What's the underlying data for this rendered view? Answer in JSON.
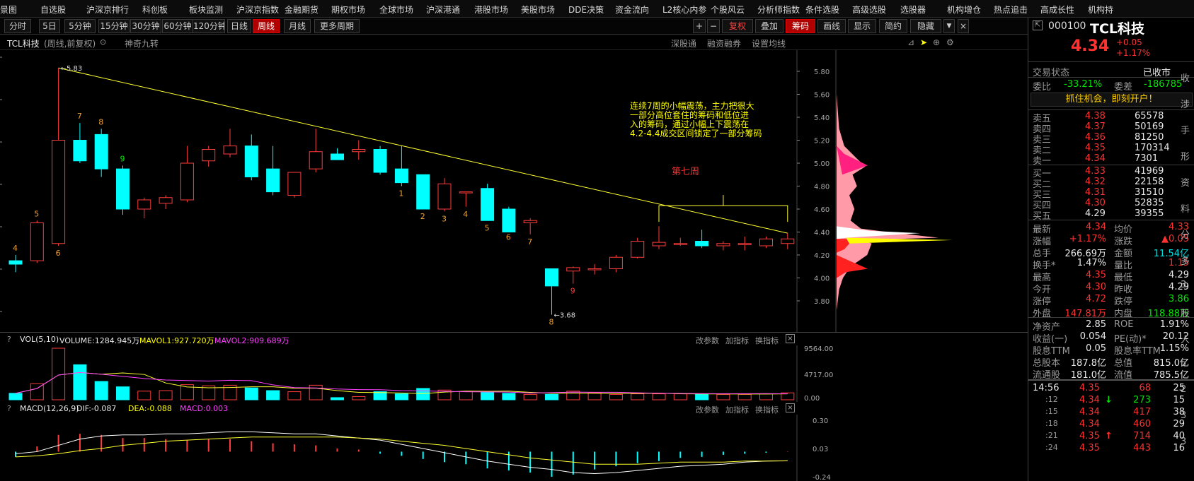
{
  "menu": [
    "景图",
    "自选股",
    "沪深京排行",
    "科创板",
    "板块监测",
    "沪深京指数",
    "金融期货",
    "期权市场",
    "全球市场",
    "沪深港通",
    "港股市场",
    "美股市场",
    "DDE决策",
    "资金流向",
    "L2核心内参",
    "个股风云",
    "分析师指数",
    "条件选股",
    "高级选股",
    "选股器",
    "机构增仓",
    "热点追击",
    "高成长性",
    "机构持"
  ],
  "periods": [
    "分时",
    "5日",
    "5分钟",
    "15分钟",
    "30分钟",
    "60分钟",
    "120分钟",
    "日线",
    "周线",
    "月线",
    "更多周期"
  ],
  "tools": [
    "+",
    "−",
    "复权",
    "叠加",
    "筹码",
    "画线",
    "显示",
    "简约",
    "隐藏"
  ],
  "stock": {
    "code": "000100",
    "name": "TCL科技",
    "price": "4.34",
    "change": "+0.05",
    "change_pct": "+1.17%"
  },
  "chart_header": {
    "name": "TCL科技",
    "mode": "(周线,前复权)",
    "indicator": "神奇九转",
    "right": [
      "深股通",
      "融资融券",
      "设置均线"
    ]
  },
  "annotation": {
    "text_lines": [
      "连续7周的小幅震荡，主力把很大",
      "一部分高位套住的筹码和低位进",
      "入的筹码，通过小幅上下震荡在",
      "4.2-4.4成交区间锁定了一部分筹码"
    ],
    "week7": "第七周"
  },
  "price_labels": [
    "5.80",
    "5.60",
    "5.40",
    "5.20",
    "5.00",
    "4.80",
    "4.60",
    "4.40",
    "4.20",
    "4.00",
    "3.80"
  ],
  "high_label": "5.83",
  "low_label": "3.68",
  "vol": {
    "name": "VOL(5,10)",
    "volume": "VOLUME:1284.945万",
    "mavol1": "MAVOL1:927.720万",
    "mavol2": "MAVOL2:909.689万",
    "axis": [
      "9564.00",
      "4717.00",
      "0.00"
    ],
    "actions": [
      "改参数",
      "加指标",
      "换指标"
    ]
  },
  "macd": {
    "name": "MACD(12,26,9)",
    "dif": "DIF:-0.087",
    "dea": "DEA:-0.088",
    "macd": "MACD:0.003",
    "axis": [
      "0.30",
      "0.03",
      "-0.24"
    ],
    "actions": [
      "改参数",
      "加指标",
      "换指标"
    ]
  },
  "chart_data": {
    "type": "candlestick",
    "candles": [
      {
        "o": 4.15,
        "h": 4.2,
        "l": 4.05,
        "c": 4.12
      },
      {
        "o": 4.15,
        "h": 4.5,
        "l": 4.13,
        "c": 4.48
      },
      {
        "o": 4.3,
        "h": 5.83,
        "l": 4.28,
        "c": 5.2
      },
      {
        "o": 5.2,
        "h": 5.35,
        "l": 5.0,
        "c": 5.02
      },
      {
        "o": 5.25,
        "h": 5.3,
        "l": 4.88,
        "c": 4.95
      },
      {
        "o": 4.95,
        "h": 4.98,
        "l": 4.55,
        "c": 4.6
      },
      {
        "o": 4.6,
        "h": 4.7,
        "l": 4.52,
        "c": 4.68
      },
      {
        "o": 4.65,
        "h": 4.72,
        "l": 4.6,
        "c": 4.7
      },
      {
        "o": 4.68,
        "h": 5.15,
        "l": 4.66,
        "c": 5.0
      },
      {
        "o": 5.02,
        "h": 5.15,
        "l": 4.97,
        "c": 5.12
      },
      {
        "o": 5.08,
        "h": 5.3,
        "l": 5.05,
        "c": 5.15
      },
      {
        "o": 5.15,
        "h": 5.25,
        "l": 4.85,
        "c": 4.88
      },
      {
        "o": 4.95,
        "h": 5.15,
        "l": 4.72,
        "c": 4.75
      },
      {
        "o": 4.72,
        "h": 4.9,
        "l": 4.7,
        "c": 4.92
      },
      {
        "o": 4.95,
        "h": 5.3,
        "l": 4.92,
        "c": 5.1
      },
      {
        "o": 5.08,
        "h": 5.13,
        "l": 5.03,
        "c": 5.03
      },
      {
        "o": 5.1,
        "h": 5.2,
        "l": 5.03,
        "c": 5.12
      },
      {
        "o": 5.12,
        "h": 5.15,
        "l": 4.9,
        "c": 4.92
      },
      {
        "o": 4.95,
        "h": 5.15,
        "l": 4.8,
        "c": 4.83
      },
      {
        "o": 4.9,
        "h": 4.9,
        "l": 4.6,
        "c": 4.6
      },
      {
        "o": 4.6,
        "h": 4.87,
        "l": 4.58,
        "c": 4.82
      },
      {
        "o": 4.75,
        "h": 4.75,
        "l": 4.62,
        "c": 4.75
      },
      {
        "o": 4.78,
        "h": 4.82,
        "l": 4.5,
        "c": 4.5
      },
      {
        "o": 4.6,
        "h": 4.62,
        "l": 4.42,
        "c": 4.4
      },
      {
        "o": 4.48,
        "h": 4.52,
        "l": 4.38,
        "c": 4.5
      },
      {
        "o": 4.08,
        "h": 4.08,
        "l": 3.68,
        "c": 3.93
      },
      {
        "o": 4.06,
        "h": 4.1,
        "l": 3.95,
        "c": 4.09
      },
      {
        "o": 4.08,
        "h": 4.12,
        "l": 4.03,
        "c": 4.08
      },
      {
        "o": 4.08,
        "h": 4.2,
        "l": 4.05,
        "c": 4.18
      },
      {
        "o": 4.18,
        "h": 4.35,
        "l": 4.17,
        "c": 4.32
      },
      {
        "o": 4.28,
        "h": 4.45,
        "l": 4.25,
        "c": 4.31
      },
      {
        "o": 4.3,
        "h": 4.35,
        "l": 4.28,
        "c": 4.3
      },
      {
        "o": 4.32,
        "h": 4.42,
        "l": 4.26,
        "c": 4.28
      },
      {
        "o": 4.28,
        "h": 4.32,
        "l": 4.24,
        "c": 4.3
      },
      {
        "o": 4.29,
        "h": 4.36,
        "l": 4.24,
        "c": 4.3
      },
      {
        "o": 4.28,
        "h": 4.36,
        "l": 4.26,
        "c": 4.34
      },
      {
        "o": 4.3,
        "h": 4.39,
        "l": 4.25,
        "c": 4.34
      }
    ],
    "td_labels": [
      {
        "i": 0,
        "t": "4",
        "pos": "above",
        "col": "org"
      },
      {
        "i": 1,
        "t": "5",
        "pos": "above",
        "col": "org"
      },
      {
        "i": 2,
        "t": "6",
        "pos": "below",
        "col": "org"
      },
      {
        "i": 3,
        "t": "7",
        "pos": "above",
        "col": "org"
      },
      {
        "i": 4,
        "t": "8",
        "pos": "above",
        "col": "org"
      },
      {
        "i": 5,
        "t": "9",
        "pos": "above",
        "col": "grn"
      },
      {
        "i": 18,
        "t": "1",
        "pos": "below",
        "col": "org"
      },
      {
        "i": 19,
        "t": "2",
        "pos": "below",
        "col": "org"
      },
      {
        "i": 20,
        "t": "3",
        "pos": "below",
        "col": "org"
      },
      {
        "i": 21,
        "t": "4",
        "pos": "below",
        "col": "org"
      },
      {
        "i": 22,
        "t": "5",
        "pos": "below",
        "col": "org"
      },
      {
        "i": 23,
        "t": "6",
        "pos": "below",
        "col": "org"
      },
      {
        "i": 24,
        "t": "7",
        "pos": "below",
        "col": "org"
      },
      {
        "i": 25,
        "t": "8",
        "pos": "below",
        "col": "org"
      },
      {
        "i": 26,
        "t": "9",
        "pos": "below",
        "col": "redt"
      }
    ],
    "volumes": [
      1200,
      3000,
      9564,
      6500,
      3400,
      2400,
      1600,
      1700,
      2800,
      2600,
      2700,
      2200,
      1700,
      1500,
      2700,
      400,
      600,
      1500,
      1100,
      2100,
      1800,
      1500,
      1400,
      1200,
      1000,
      1000,
      1600,
      1300,
      1000,
      1100,
      1100,
      1100,
      1100,
      1000,
      1000,
      1100,
      1285
    ],
    "vol_ylim": [
      0,
      9564
    ],
    "macd_hist": [
      -0.05,
      0.05,
      0.16,
      0.17,
      0.16,
      0.13,
      0.13,
      0.12,
      0.11,
      0.12,
      0.12,
      0.1,
      0.08,
      0.07,
      0.06,
      0.03,
      0.02,
      -0.02,
      -0.04,
      -0.07,
      -0.1,
      -0.12,
      -0.16,
      -0.18,
      -0.2,
      -0.24,
      -0.22,
      -0.17,
      -0.14,
      -0.11,
      -0.09,
      -0.06,
      -0.05,
      -0.03,
      -0.02,
      -0.01,
      0.003
    ],
    "dif": [
      -0.02,
      0.0,
      0.06,
      0.12,
      0.15,
      0.16,
      0.16,
      0.17,
      0.17,
      0.18,
      0.19,
      0.19,
      0.18,
      0.17,
      0.17,
      0.15,
      0.13,
      0.11,
      0.07,
      0.03,
      -0.01,
      -0.05,
      -0.09,
      -0.12,
      -0.15,
      -0.17,
      -0.2,
      -0.21,
      -0.2,
      -0.18,
      -0.16,
      -0.14,
      -0.13,
      -0.12,
      -0.1,
      -0.09,
      -0.087
    ],
    "dea": [
      -0.05,
      -0.04,
      -0.02,
      0.01,
      0.03,
      0.06,
      0.08,
      0.1,
      0.11,
      0.12,
      0.13,
      0.14,
      0.14,
      0.14,
      0.14,
      0.14,
      0.13,
      0.12,
      0.1,
      0.08,
      0.06,
      0.03,
      0.0,
      -0.03,
      -0.06,
      -0.08,
      -0.1,
      -0.12,
      -0.12,
      -0.12,
      -0.11,
      -0.1,
      -0.1,
      -0.1,
      -0.09,
      -0.09,
      -0.088
    ],
    "macd_ylim": [
      -0.24,
      0.3
    ],
    "price_ylim": [
      3.68,
      5.83
    ]
  },
  "status": {
    "label": "交易状态",
    "value": "已收市"
  },
  "weibi": {
    "l1": "委比",
    "v1": "-33.21%",
    "l2": "委差",
    "v2": "-186785"
  },
  "promo": "抓住机会，即刻开户！",
  "asks": [
    {
      "n": "卖五",
      "p": "4.38",
      "v": "65578"
    },
    {
      "n": "卖四",
      "p": "4.37",
      "v": "50169"
    },
    {
      "n": "卖三",
      "p": "4.36",
      "v": "81250"
    },
    {
      "n": "卖二",
      "p": "4.35",
      "v": "170314"
    },
    {
      "n": "卖一",
      "p": "4.34",
      "v": "7301"
    }
  ],
  "bids": [
    {
      "n": "买一",
      "p": "4.33",
      "v": "41969"
    },
    {
      "n": "买二",
      "p": "4.32",
      "v": "22158"
    },
    {
      "n": "买三",
      "p": "4.31",
      "v": "31510"
    },
    {
      "n": "买四",
      "p": "4.30",
      "v": "52835"
    },
    {
      "n": "买五",
      "p": "4.29",
      "v": "39355"
    }
  ],
  "quote": [
    {
      "l": "最新",
      "v": "4.34",
      "vc": "redt",
      "l2": "均价",
      "v2": "4.33",
      "v2c": "redt"
    },
    {
      "l": "涨幅",
      "v": "+1.17%",
      "vc": "redt",
      "l2": "涨跌",
      "v2": "▲0.05",
      "v2c": "redt"
    },
    {
      "l": "总手",
      "v": "266.69万",
      "vc": "wht",
      "l2": "金额",
      "v2": "11.54亿",
      "v2c": "cy"
    },
    {
      "l": "换手*",
      "v": "1.47%",
      "vc": "wht",
      "l2": "量比",
      "v2": "1.15",
      "v2c": "redt"
    },
    {
      "l": "最高",
      "v": "4.35",
      "vc": "redt",
      "l2": "最低",
      "v2": "4.29",
      "v2c": "wht"
    },
    {
      "l": "今开",
      "v": "4.30",
      "vc": "redt",
      "l2": "昨收",
      "v2": "4.29",
      "v2c": "wht"
    },
    {
      "l": "涨停",
      "v": "4.72",
      "vc": "redt",
      "l2": "跌停",
      "v2": "3.86",
      "v2c": "grn"
    },
    {
      "l": "外盘",
      "v": "147.81万",
      "vc": "redt",
      "l2": "内盘",
      "v2": "118.88万",
      "v2c": "grn"
    }
  ],
  "fund": [
    {
      "l": "净资产",
      "v": "2.85",
      "l2": "ROE",
      "v2": "1.91%"
    },
    {
      "l": "收益(一)",
      "v": "0.054",
      "l2": "PE(动)*",
      "v2": "20.12"
    },
    {
      "l": "股息TTM",
      "v": "0.05",
      "l2": "股息率TTM",
      "v2": "1.15%"
    },
    {
      "l": "总股本",
      "v": "187.8亿",
      "l2": "总值",
      "v2": "815.0亿"
    },
    {
      "l": "流通股",
      "v": "181.0亿",
      "l2": "流值",
      "v2": "785.5亿"
    }
  ],
  "ticks": [
    {
      "t": "14:56",
      "p": "4.35",
      "a": "",
      "v": "68",
      "n": "25",
      "vc": "redt"
    },
    {
      "t": ":12",
      "p": "4.34",
      "a": "↓",
      "v": "273",
      "n": "15",
      "vc": "grn"
    },
    {
      "t": ":15",
      "p": "4.34",
      "a": "",
      "v": "417",
      "n": "38",
      "vc": "redt"
    },
    {
      "t": ":18",
      "p": "4.34",
      "a": "",
      "v": "460",
      "n": "29",
      "vc": "redt"
    },
    {
      "t": ":21",
      "p": "4.35",
      "a": "↑",
      "v": "714",
      "n": "40",
      "vc": "redt"
    },
    {
      "t": ":24",
      "p": "4.35",
      "a": "",
      "v": "443",
      "n": "16",
      "vc": "redt"
    }
  ],
  "right_edge": [
    "收",
    "涉",
    "手",
    "形",
    "资",
    "料",
    "分",
    "多",
    "3",
    "股",
    "人",
    "5",
    "2",
    "3",
    "3"
  ]
}
